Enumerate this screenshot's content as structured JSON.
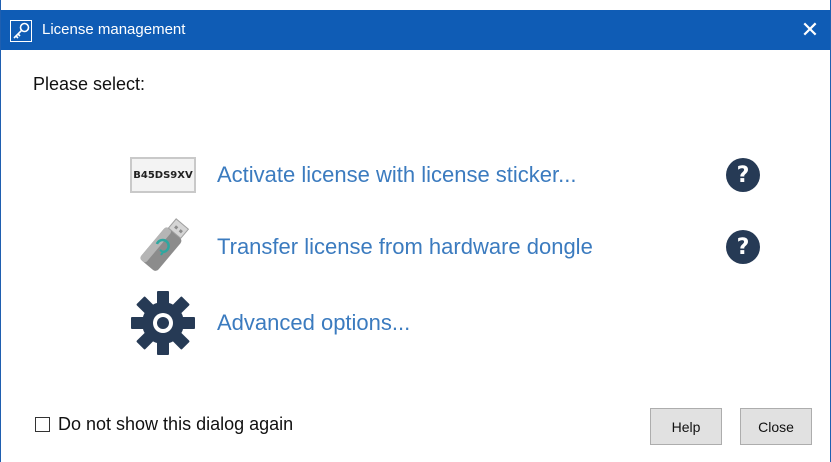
{
  "window": {
    "title": "License management",
    "close_glyph": "✕"
  },
  "prompt": "Please select:",
  "options": [
    {
      "label": "Activate license with license sticker...",
      "icon": "license-sticker-icon",
      "sticker_code": "B45DS9XV",
      "has_help": true
    },
    {
      "label": "Transfer license from hardware dongle",
      "icon": "usb-dongle-icon",
      "has_help": true
    },
    {
      "label": "Advanced options...",
      "icon": "gear-icon",
      "has_help": false
    }
  ],
  "help_glyph": "?",
  "footer": {
    "checkbox_label": "Do not show this dialog again",
    "checkbox_checked": false,
    "help_button": "Help",
    "close_button": "Close"
  },
  "colors": {
    "titlebar": "#0f5cb5",
    "link": "#3b7bbf",
    "help_icon_bg": "#263a55"
  }
}
